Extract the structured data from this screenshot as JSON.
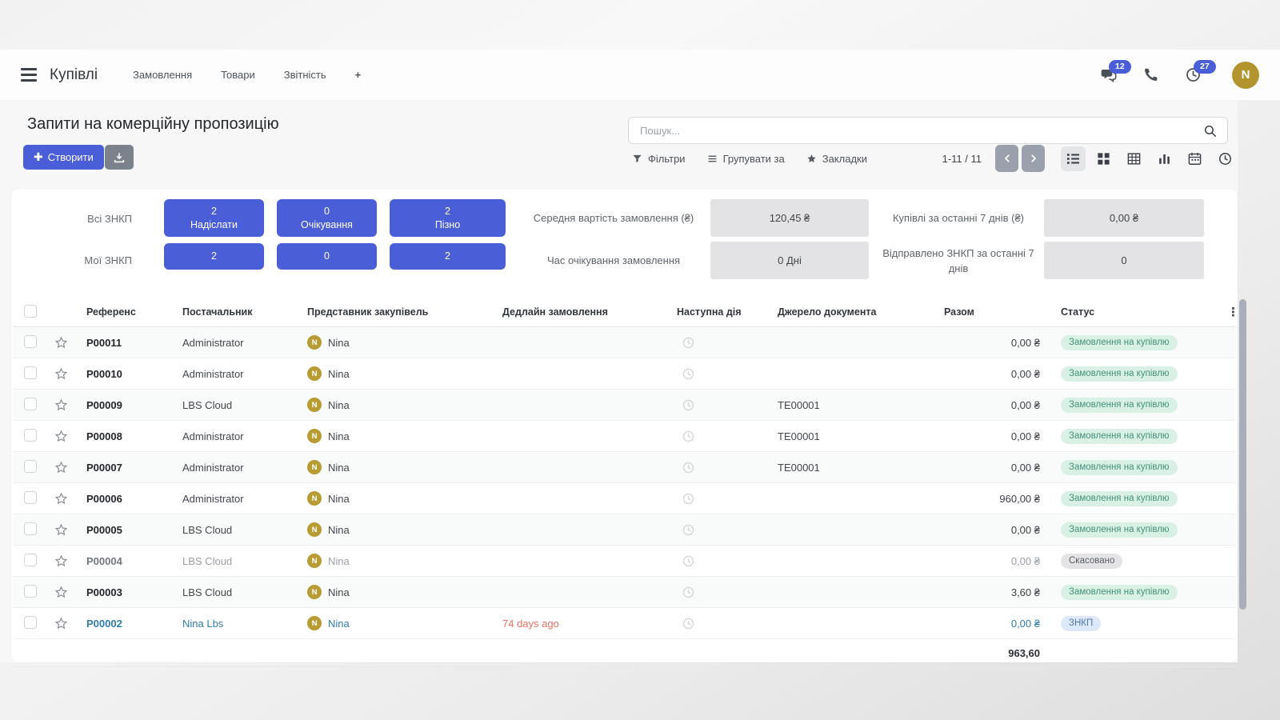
{
  "navbar": {
    "app_title": "Купівлі",
    "menu_items": [
      "Замовлення",
      "Товари",
      "Звітність"
    ],
    "plus_label": "+",
    "messages_badge": "12",
    "activities_badge": "27",
    "avatar_initial": "N"
  },
  "control_panel": {
    "title": "Запити на комерційну пропозицію",
    "create_label": "Створити",
    "search_placeholder": "Пошук...",
    "filters_label": "Фільтри",
    "group_by_label": "Групувати за",
    "favorites_label": "Закладки",
    "pager": "1-11 / 11"
  },
  "kpi": {
    "row_labels": [
      "Всі ЗНКП",
      "Мої ЗНКП"
    ],
    "buttons": [
      {
        "count": "2",
        "label": "Надіслати",
        "my_count": "2"
      },
      {
        "count": "0",
        "label": "Очікування",
        "my_count": "0"
      },
      {
        "count": "2",
        "label": "Пізно",
        "my_count": "2"
      }
    ]
  },
  "stats": [
    {
      "label": "Середня вартість замовлення (₴)",
      "value": "120,45 ₴"
    },
    {
      "label": "Час очікування замовлення",
      "value": "0  Дні"
    },
    {
      "label": "Купівлі за останні 7 днів (₴)",
      "value": "0,00 ₴"
    },
    {
      "label": "Відправлено ЗНКП за останні 7 днів",
      "value": "0"
    }
  ],
  "table": {
    "headers": [
      "Референс",
      "Постачальник",
      "Представник закупівель",
      "Дедлайн замовлення",
      "Наступна дія",
      "Джерело документа",
      "Разом",
      "Статус"
    ],
    "avatar_initial": "N",
    "rows": [
      {
        "ref": "P00011",
        "supplier": "Administrator",
        "rep": "Nina",
        "deadline": "",
        "source": "",
        "total": "0,00 ₴",
        "status": "Замовлення на купівлю"
      },
      {
        "ref": "P00010",
        "supplier": "Administrator",
        "rep": "Nina",
        "deadline": "",
        "source": "",
        "total": "0,00 ₴",
        "status": "Замовлення на купівлю"
      },
      {
        "ref": "P00009",
        "supplier": "LBS Cloud",
        "rep": "Nina",
        "deadline": "",
        "source": "TE00001",
        "total": "0,00 ₴",
        "status": "Замовлення на купівлю"
      },
      {
        "ref": "P00008",
        "supplier": "Administrator",
        "rep": "Nina",
        "deadline": "",
        "source": "TE00001",
        "total": "0,00 ₴",
        "status": "Замовлення на купівлю"
      },
      {
        "ref": "P00007",
        "supplier": "Administrator",
        "rep": "Nina",
        "deadline": "",
        "source": "TE00001",
        "total": "0,00 ₴",
        "status": "Замовлення на купівлю"
      },
      {
        "ref": "P00006",
        "supplier": "Administrator",
        "rep": "Nina",
        "deadline": "",
        "source": "",
        "total": "960,00 ₴",
        "status": "Замовлення на купівлю"
      },
      {
        "ref": "P00005",
        "supplier": "LBS Cloud",
        "rep": "Nina",
        "deadline": "",
        "source": "",
        "total": "0,00 ₴",
        "status": "Замовлення на купівлю"
      },
      {
        "ref": "P00004",
        "supplier": "LBS Cloud",
        "rep": "Nina",
        "deadline": "",
        "source": "",
        "total": "0,00 ₴",
        "status": "Скасовано"
      },
      {
        "ref": "P00003",
        "supplier": "LBS Cloud",
        "rep": "Nina",
        "deadline": "",
        "source": "",
        "total": "3,60 ₴",
        "status": "Замовлення на купівлю"
      },
      {
        "ref": "P00002",
        "supplier": "Nina Lbs",
        "rep": "Nina",
        "deadline": "74 days ago",
        "source": "",
        "total": "0,00 ₴",
        "status": "ЗНКП"
      }
    ],
    "footer_total": "963,60"
  },
  "icons": {
    "navbar": [
      "menu-icon",
      "chat-icon",
      "phone-icon",
      "clock-icon"
    ],
    "control": [
      "search-icon",
      "download-icon",
      "filter-funnel-icon",
      "group-by-icon",
      "bookmark-star-icon",
      "chevron-left-icon",
      "chevron-right-icon"
    ],
    "views": [
      "list-view-icon",
      "kanban-view-icon",
      "pivot-view-icon",
      "graph-view-icon",
      "calendar-view-icon",
      "activity-view-icon"
    ],
    "table": [
      "star-icon",
      "clock-icon",
      "kebab-menu-icon"
    ]
  },
  "colors": {
    "accent": "#4a5ed8",
    "avatar_gold": "#b2952e",
    "status_success_bg": "#d9f0e5",
    "status_success_text": "#43937a",
    "status_cancel_bg": "#e4e4e7",
    "status_cancel_text": "#5a5f66",
    "status_info_bg": "#dde8f8",
    "status_info_text": "#5578ad",
    "link_blue": "#2e7cab",
    "danger_red": "#ed6f64",
    "stat_box_bg": "#e3e3e5"
  }
}
